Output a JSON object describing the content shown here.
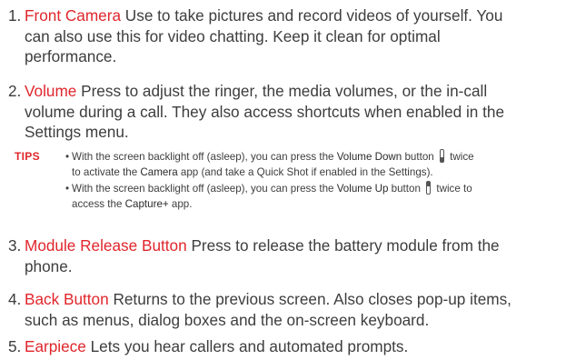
{
  "items": [
    {
      "number": "1.",
      "term": "Front Camera",
      "lines": [
        " Use to take pictures and record videos of yourself. You",
        "can also use this for video chatting. Keep it clean for optimal",
        "performance."
      ]
    },
    {
      "number": "2.",
      "term": "Volume",
      "lines": [
        " Press to adjust the ringer, the media volumes, or the in-call",
        "volume during a call. They also access shortcuts when enabled in the",
        "Settings menu."
      ]
    },
    {
      "number": "3.",
      "term": "Module Release Button",
      "lines": [
        " Press to release the battery module from the",
        "phone."
      ]
    },
    {
      "number": "4.",
      "term": "Back Button",
      "lines": [
        " Returns to the previous screen. Also closes pop-up items,",
        "such as menus, dialog boxes and the on-screen keyboard."
      ]
    },
    {
      "number": "5.",
      "term": "Earpiece",
      "lines": [
        " Lets you hear callers and automated prompts."
      ]
    }
  ],
  "tips": {
    "label": "TIPS",
    "bullet": "•",
    "tip1": {
      "a": "With the screen backlight off (asleep), you can press the ",
      "key": "Volume Down",
      "b": " button ",
      "c": " twice",
      "d": "to activate the ",
      "app": "Camera",
      "e": " app (and take a Quick Shot if enabled in the Settings)."
    },
    "tip2": {
      "a": "With the screen backlight off (asleep), you can press the ",
      "key": "Volume Up",
      "b": " button ",
      "c": " twice to",
      "d": "access the ",
      "app": "Capture+",
      "e": " app."
    }
  }
}
